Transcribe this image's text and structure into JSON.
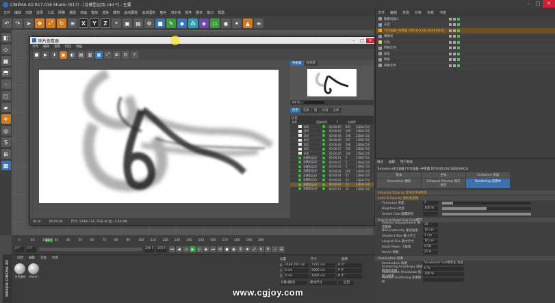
{
  "window": {
    "title": "CINEMA 4D R17.016 Studio (R17) - [龙横型运动.c4d *] - 主要"
  },
  "main_menu": [
    "文件",
    "编辑",
    "创建",
    "选择",
    "工具",
    "网格",
    "捕捉",
    "动画",
    "模拟",
    "渲染",
    "雕刻",
    "运动跟踪",
    "运动图形",
    "角色",
    "流水线",
    "插件",
    "脚本",
    "窗口",
    "帮助"
  ],
  "toolbar_axes": [
    "X",
    "Y",
    "Z"
  ],
  "picture_viewer": {
    "title": "图片查看器",
    "menu": [
      "文件",
      "编辑",
      "查看",
      "比较",
      "动画"
    ],
    "zoom": "64 %",
    "status_time": "00:00:06",
    "status_info": "尺寸: 1280x720, RGB (8 位), 2.84 MB",
    "nav_tabs": [
      "导航器",
      "柱状图"
    ],
    "thumb_zoom": "64 %",
    "info_tabs": [
      "历史",
      "信息",
      "层",
      "过滤",
      "立体"
    ],
    "history_header": "历史",
    "history_cols": [
      "名称",
      "渲染时间",
      "F",
      "分辨率"
    ],
    "history_rows": [
      {
        "name": "206",
        "time": "00:00:05",
        "f": "201",
        "res": "1280x720"
      },
      {
        "name": "205",
        "time": "00:00:06",
        "f": "199",
        "res": "1280x720"
      },
      {
        "name": "204",
        "time": "00:00:06",
        "f": "198",
        "res": "1280x720"
      },
      {
        "name": "203",
        "time": "00:00:06",
        "f": "197",
        "res": "1280x720"
      },
      {
        "name": "202",
        "time": "00:00:06",
        "f": "196",
        "res": "1280x720"
      },
      {
        "name": "201",
        "time": "00:00:07",
        "f": "195",
        "res": "1280x720"
      },
      {
        "name": "200",
        "time": "00:00:06",
        "f": "194",
        "res": "1280x720"
      },
      {
        "name": "龙横型运动 *",
        "time": "00:00:01",
        "f": "5",
        "res": "1280x720"
      },
      {
        "name": "龙横型运动 *",
        "time": "00:00:01",
        "f": "5",
        "res": "1280x720"
      },
      {
        "name": "龙横型运动 *",
        "time": "00:00:03",
        "f": "5",
        "res": "1280x720"
      },
      {
        "name": "龙横型运动 *",
        "time": "00:00:03",
        "f": "295",
        "res": "1280x720"
      },
      {
        "name": "龙横型运动 *",
        "time": "00:00:04",
        "f": "22",
        "res": "1280x720"
      },
      {
        "name": "龙横型运动 *",
        "time": "00:00:03",
        "f": "22",
        "res": "1280x720"
      },
      {
        "name": "龙横型运动 *",
        "time": "00:00:06",
        "f": "22",
        "res": "1280x720"
      },
      {
        "name": "龙横型运动 *",
        "time": "00:01:01",
        "f": "22",
        "res": "1280x720"
      }
    ]
  },
  "object_manager": {
    "menu": [
      "文件",
      "编辑",
      "查看",
      "对象",
      "标签",
      "书签"
    ],
    "objects": [
      {
        "name": "随着机器人",
        "color": "#9a9a9a"
      },
      {
        "name": "天空",
        "color": "#7aa6d8"
      },
      {
        "name": "TFD渲器--中英版 DRY(QQ:QQ:34283601)",
        "color": "#f0a030",
        "selected": true
      },
      {
        "name": "摄像机",
        "color": "#9a9a9a"
      },
      {
        "name": "灯光",
        "color": "#d8d060"
      },
      {
        "name": "转换元件",
        "color": "#9a9a9a"
      },
      {
        "name": "样条",
        "color": "#9a9a9a"
      },
      {
        "name": "样条",
        "color": "#9a9a9a"
      },
      {
        "name": "转换元件",
        "color": "#9a9a9a"
      }
    ]
  },
  "attribute_manager": {
    "menu": [
      "模式",
      "编辑",
      "用户数据"
    ],
    "title": "TurbulenceFD渲器 [TFD渲器--中英版 DRY(QQ:QQ:34283601)]",
    "tabs": [
      "基本",
      "坐标",
      "Container 容器",
      "Simulation 模拟",
      "Viewport Preview 窗口预览",
      "Rendering 渲染中"
    ],
    "active_tab": "Rendering 渲染中",
    "sections": {
      "separate_opacity": "Separate Opacity 混浊的不透明度",
      "color_opacity": "Color & Opacity 颜色和透明",
      "subgrid": "Sub-Grid Detail Sub-Grid细节",
      "illumination": "Illumination 照明"
    },
    "params_color": [
      {
        "label": "Thickness 厚度",
        "value": "2",
        "fill": 0.12
      },
      {
        "label": "Brightness亮度",
        "value": "100 %",
        "fill": 0.5
      },
      {
        "label": "Smoke Color烟雾颜色",
        "value": "",
        "fill": 1.0
      }
    ],
    "params_subgrid": [
      {
        "label": "Velocity Displacement 速度置换",
        "value": "30",
        "fill": 0.0
      },
      {
        "label": "Noise Intensity 噪波强度",
        "value": "10 cm",
        "fill": 0.0
      },
      {
        "label": "Smallest Size 最小尺寸",
        "value": "1 cm",
        "fill": 0.0
      },
      {
        "label": "Largest Size 最大尺寸",
        "value": "10 cm",
        "fill": 0.0
      },
      {
        "label": "Small Power 小能量",
        "value": "0.56",
        "fill": 0.0
      },
      {
        "label": "Period 周期",
        "value": "25.9",
        "fill": 0.0
      }
    ],
    "params_illum": [
      {
        "label": "Illumination 照明",
        "value": "Visualized Fast黄黑化 快速"
      },
      {
        "label": "Scattering Anisotropy 前后散射的选项",
        "value": "0 %"
      },
      {
        "label": "Illumination Resolution 照度分辨率",
        "value": "100 %"
      },
      {
        "label": "Multiple Scattering 多重散射",
        "value": ""
      }
    ]
  },
  "timeline": {
    "ticks": [
      "0",
      "10",
      "20",
      "30",
      "40",
      "50",
      "60",
      "70",
      "80",
      "90",
      "100",
      "110",
      "120",
      "130",
      "140",
      "150",
      "160",
      "170",
      "180",
      "190",
      "200"
    ],
    "current_frame": "22 F",
    "start": "0 F",
    "fields": [
      "0 F",
      "0 F",
      "200 F",
      "200 F"
    ]
  },
  "material_panel": {
    "menu": [
      "创建",
      "编辑",
      "功能",
      "纹理"
    ],
    "materials": [
      "白色幕布",
      "Materi"
    ]
  },
  "coordinates": {
    "headers": [
      "位置",
      "尺寸",
      "旋转"
    ],
    "rows": [
      {
        "axis": "X",
        "pos": "2189.761 cm",
        "size": "7252 cm",
        "rot": "H 0°"
      },
      {
        "axis": "Y",
        "pos": "0 cm",
        "size": "2000 cm",
        "rot": "P 0°"
      },
      {
        "axis": "Z",
        "pos": "0 cm",
        "size": "1000 cm",
        "rot": "B 0°"
      }
    ],
    "mode": "对象(相对)",
    "size_mode": "绝对尺寸",
    "apply": "应用"
  },
  "branding": {
    "maxon": "MAXON CINEMA 4D",
    "watermark": "www.cgjoy.com"
  }
}
